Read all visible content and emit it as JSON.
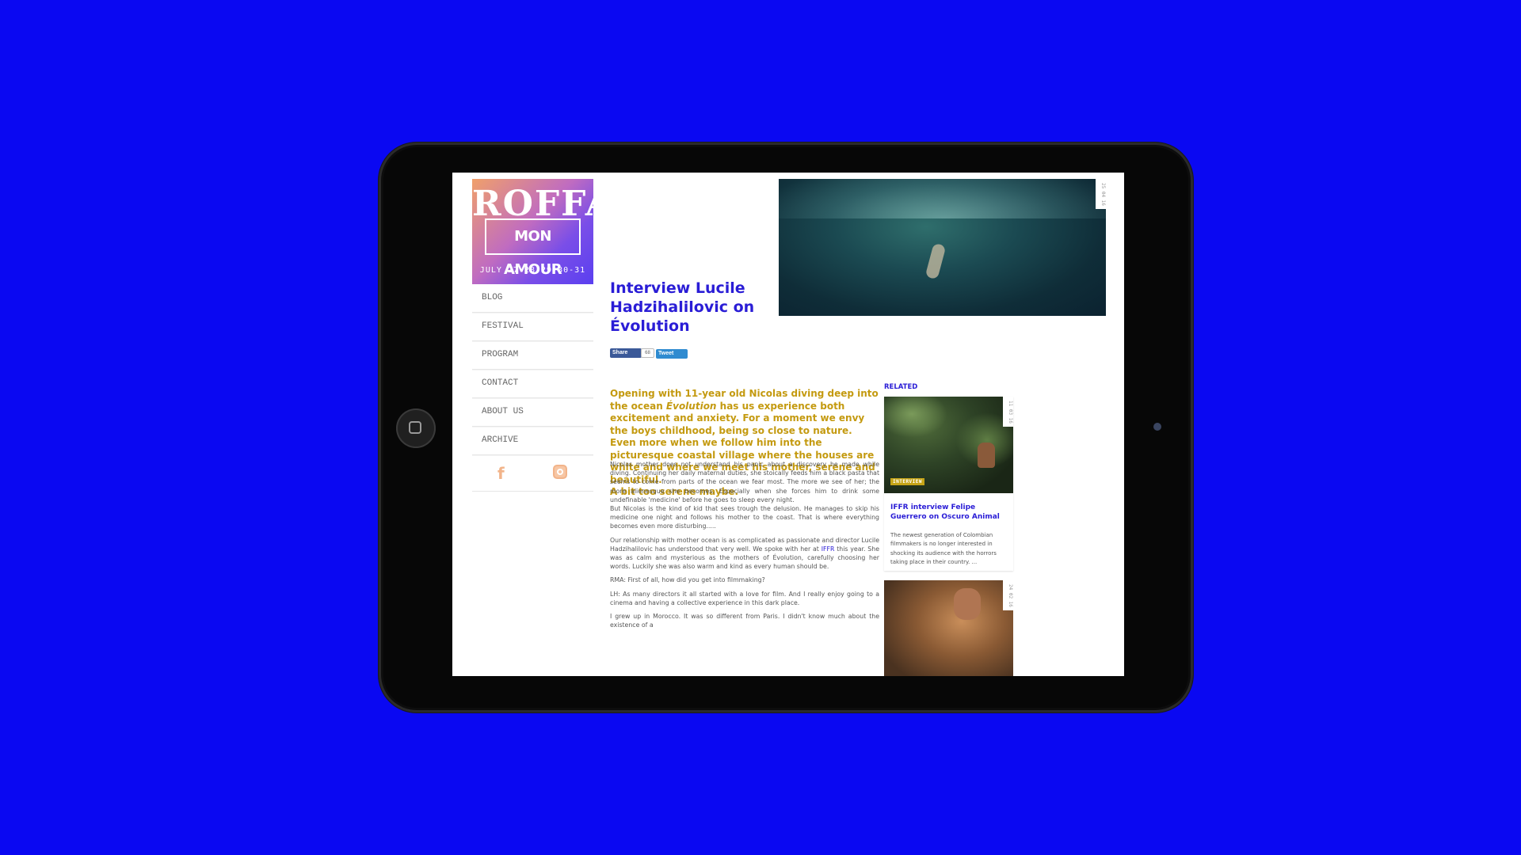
{
  "logo": {
    "title": "ROFFA",
    "subtitle": "MON AMOUR",
    "dates": "JULY 27-28-29-30-31"
  },
  "nav": {
    "items": [
      {
        "label": "BLOG"
      },
      {
        "label": "FESTIVAL"
      },
      {
        "label": "PROGRAM"
      },
      {
        "label": "CONTACT"
      },
      {
        "label": "ABOUT US"
      },
      {
        "label": "ARCHIVE"
      }
    ]
  },
  "social": {
    "facebook_icon": "facebook-icon",
    "instagram_icon": "instagram-icon"
  },
  "article": {
    "hero_date": "25 04 16",
    "title": "Interview Lucile Hadzihalilovic on Évolution",
    "share_label": "Share",
    "share_count": "68",
    "tweet_label": "Tweet",
    "intro_lead": "Opening with  11-year old Nicolas diving deep into the ocean ",
    "intro_film": "Évolution",
    "intro_rest": " has us experience both excitement and anxiety. For a moment we envy the boys childhood, being so close to nature. Even more when we follow him into the picturesque coastal village where the houses are white and where we meet his mother, serene and beautiful.",
    "intro_end": "A bit too serene maybe.",
    "para1": "Nicolas mother does not understand his panic about a discovery he made while diving. Continuing her daily maternal duties, she stoically feeds him a black pasta that seems to come from parts of the ocean we fear most. The more we see of her; the more alienesque she becomes. Especially when she forces him to drink some undefinable 'medicine' before he goes to sleep every night.",
    "para2": "But Nicolas is the kind of kid that sees trough the delusion. He manages to skip his medicine one night and follows his mother to the coast. That is where everything becomes even more disturbing.....",
    "para3_before": "Our relationship with mother ocean is as complicated as passionate and director Lucile Hadzihalilovic has understood that very well. We spoke with her at ",
    "para3_link": "IFFR",
    "para3_after": " this year. She was as calm and mysterious as the mothers of Évolution, carefully choosing her words. Luckily she was also warm and kind as every human should be.",
    "para4": "RMA: First of all, how did you get into filmmaking?",
    "para5": "LH: As many directors it all started with a love for film. And I really enjoy going to a cinema and having a collective experience in this dark place.",
    "para6": "I grew up in Morocco. It was so different from Paris. I didn't know much about the existence of a"
  },
  "related": {
    "label": "RELATED",
    "card1": {
      "date": "11 03 16",
      "badge": "INTERVIEW",
      "title": "IFFR interview Felipe Guerrero on Oscuro Animal",
      "excerpt": "The newest generation of Colombian filmmakers is no longer interested in shocking its audience with the horrors taking place in their country. ..."
    },
    "card2": {
      "date": "24 02 16"
    }
  },
  "colors": {
    "background": "#0a08f2",
    "accent_blue": "#2a1dd6",
    "accent_gold": "#c49a10"
  }
}
